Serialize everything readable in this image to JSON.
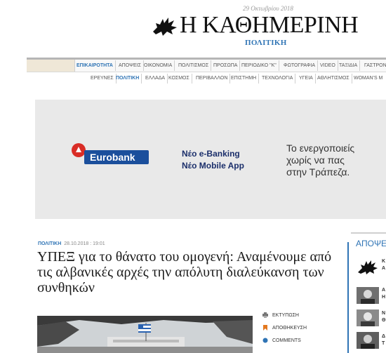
{
  "masthead": {
    "date": "29 Οκτωβρίου 2018",
    "title": "Η ΚΑΘΗΜΕΡΙΝΗ",
    "section": "ΠΟΛΙΤΙΚΗ"
  },
  "nav_primary": [
    "ΕΠΙΚΑΙΡΟΤΗΤΑ",
    "ΑΠΟΨΕΙΣ",
    "ΟΙΚΟΝΟΜΙΑ",
    "ΠΟΛΙΤΙΣΜΟΣ",
    "ΠΡΟΣΩΠΑ",
    "ΠΕΡΙΟΔΙΚΟ \"Κ\"",
    "ΦΩΤΟΓΡΑΦΙΑ",
    "VIDEO",
    "ΤΑΞΙΔΙΑ",
    "ΓΑΣΤΡΟΝ"
  ],
  "nav_secondary": [
    "ΕΡΕΥΝΕΣ",
    "ΠΟΛΙΤΙΚΗ",
    "ΕΛΛΑΔΑ",
    "ΚΟΣΜΟΣ",
    "ΠΕΡΙΒΑΛΛΟΝ",
    "ΕΠΙΣΤΗΜΗ",
    "ΤΕΧΝΟΛΟΓΙΑ",
    "ΥΓΕΙΑ",
    "ΑΘΛΗΤΙΣΜΟΣ",
    "WOMAN'S M"
  ],
  "ad": {
    "brand": "Eurobank",
    "line1": "Νέο e-Banking",
    "line2": "Νέο Mobile App",
    "slogan": [
      "Το ενεργοποιείς",
      "χωρίς να πας",
      "στην Τράπεζα."
    ]
  },
  "article": {
    "category": "ΠΟΛΙΤΙΚΗ",
    "timestamp": "28.10.2018 : 19:01",
    "headline": "ΥΠΕΞ για το θάνατο του ομογενή: Αναμένουμε από τις αλβανικές αρχές την απόλυτη διαλεύκανση των συνθηκών"
  },
  "tools": {
    "print": "ΕΚΤΥΠΩΣΗ",
    "save": "ΑΠΟΘΗΚΕΥΣΗ",
    "comments": "COMMENTS"
  },
  "sidebar": {
    "title": "ΑΠΟΨΕΙΣ",
    "items": [
      {
        "lines": [
          "Κ",
          "Α"
        ]
      },
      {
        "lines": [
          "Α",
          "Η"
        ]
      },
      {
        "lines": [
          "Ν",
          "Θ"
        ]
      },
      {
        "lines": [
          "Δ",
          "Τ"
        ]
      }
    ]
  },
  "colors": {
    "accent": "#2f74b5",
    "ad_brand": "#1b4f9c",
    "ad_red": "#d92d26"
  }
}
